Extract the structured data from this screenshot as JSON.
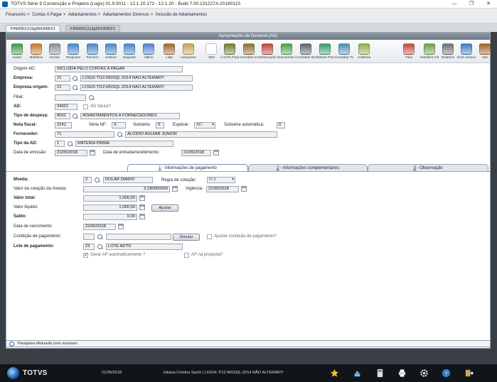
{
  "window": {
    "title": "TOTVS Série 9 Construção e Projetos (Logix) 01.9.5011  -  12.1.20.172  - 12.1.20  - Build 7.00.131227A-20180123",
    "minimize": "—",
    "restore": "❐",
    "close": "✕"
  },
  "breadcrumb": [
    "Financeiro",
    "Contas A Pagar",
    "Adiantamentos",
    "Adiantamentos Diversos",
    "Inclusão de Adiantamentos"
  ],
  "tabs": [
    {
      "label": "FIN0061(1)\\lg991958/21",
      "active": true
    },
    {
      "label": "FIN0061(1)\\lg991958/21",
      "active": false
    }
  ],
  "panel_title": "Apropriações de Despesa (AD)",
  "toolbar": {
    "items": [
      {
        "label": "Incluir",
        "icon": "add-icon",
        "color": "#3f9a48"
      },
      {
        "label": "Modificar",
        "icon": "edit-icon",
        "color": "#c07a2c"
      },
      {
        "label": "Excluir",
        "icon": "delete-icon",
        "color": "#8b8f95"
      },
      {
        "label": "Pesquisar",
        "icon": "search-icon",
        "color": "#4a87c9"
      },
      {
        "label": "Primeiro",
        "icon": "first-icon",
        "color": "#4a87c9"
      },
      {
        "label": "Anterior",
        "icon": "previous-icon",
        "color": "#4a87c9"
      },
      {
        "label": "Seguinte",
        "icon": "next-icon",
        "color": "#4a87c9"
      },
      {
        "label": "Último",
        "icon": "last-icon",
        "color": "#4a87c9"
      },
      {
        "label": "Lista",
        "icon": "list-icon",
        "color": "#a06a2a"
      },
      {
        "label": "Lançamen",
        "icon": "entries-icon",
        "color": "#c6a552"
      },
      {
        "label": "AEN",
        "icon": "aen-icon",
        "color": "#ffffff"
      },
      {
        "label": "A.D.Pa Financeiro",
        "icon": "finance-icon",
        "color": "#6e7f2e"
      },
      {
        "label": "Consultar Impostos",
        "icon": "taxes-icon",
        "color": "#8c6b2e"
      },
      {
        "label": "Observação",
        "icon": "note-icon",
        "color": "#c04040"
      },
      {
        "label": "Documento & Título",
        "icon": "document-icon",
        "color": "#4aa24a"
      },
      {
        "label": "Consultar Itens",
        "icon": "items-icon",
        "color": "#5b6470"
      },
      {
        "label": "Efetivar Previsão",
        "icon": "forecast-icon",
        "color": "#3e9a6a"
      },
      {
        "label": "Consultar Transf.",
        "icon": "transfer-icon",
        "color": "#4a8fb0"
      },
      {
        "label": "Auditoria",
        "icon": "audit-icon",
        "color": "#8bb04a"
      },
      {
        "label": "Filial",
        "icon": "branch-icon",
        "color": "#c54a3a"
      },
      {
        "label": "Detalhes Cotação",
        "icon": "quote-icon",
        "color": "#6ea24a"
      },
      {
        "label": "Relatório",
        "icon": "printer-icon",
        "color": "#6b7077"
      },
      {
        "label": "Docs associados",
        "icon": "attached-docs-icon",
        "color": "#3b7cc4"
      },
      {
        "label": "Sair",
        "icon": "exit-icon",
        "color": "#a0642a"
      }
    ]
  },
  "form": {
    "origem_ad": {
      "label": "Origem AD:",
      "value": "INCLUÍDA PELO CONTAS A PAGAR"
    },
    "empresa": {
      "label": "Empresa:",
      "code": "21",
      "name": "LOGIX-TI12-MSSQL-2014 NÃO ALTERAR!!!"
    },
    "empresa_origem": {
      "label": "Empresa origem:",
      "code": "21",
      "name": "LOGIX-TI12-MSSQL-2014 NÃO ALTERAR!!!"
    },
    "filial": {
      "label": "Filial:",
      "value": ""
    },
    "ad": {
      "label": "AD:",
      "value": "34921",
      "fatura_label": "AD fatura?"
    },
    "tipo_despesa": {
      "label": "Tipo de despesa:",
      "code": "8001",
      "name": "ADIANTAMENTOS A FORNECEDORES"
    },
    "nota_fiscal": {
      "label": "Nota fiscal:",
      "value": "2241",
      "serie_label": "Série NF:",
      "serie": "X",
      "subserie_label": "Subsérie:",
      "subserie": "0",
      "especie_label": "Espécie:",
      "especie": "AD",
      "subserie_auto_label": "Subsérie automática:",
      "subserie_auto": "0"
    },
    "fornecedor": {
      "label": "Fornecedor:",
      "code": "71",
      "name": "ALCIDIO AGUIAR JUNIOR"
    },
    "tipo_ad": {
      "label": "Tipo da AD:",
      "code": "1",
      "name": "MATERIA PRIMA"
    },
    "data_emissao": {
      "label": "Data de emissão:",
      "value": "21/05/2018"
    },
    "data_entrada": {
      "label": "Data de entrada/recebimento:",
      "value": "21/05/2018"
    }
  },
  "subtabs": [
    {
      "num": "1",
      "label": " - Informações de pagamento",
      "active": true
    },
    {
      "num": "2",
      "label": " - Informações complementares",
      "active": false
    },
    {
      "num": "3",
      "label": " - Observação",
      "active": false
    }
  ],
  "payment": {
    "moeda": {
      "label": "Moeda:",
      "code": "2",
      "name": "DOLAR DIARIO"
    },
    "regra_cotacao": {
      "label": "Regra de cotação:",
      "value": "D-3"
    },
    "valor_cotacao": {
      "label": "Valor da cotação da moeda:",
      "value": "3,180000000"
    },
    "vigencia": {
      "label": "Vigência:",
      "value": "21/05/2018"
    },
    "valor_total": {
      "label": "Valor total:",
      "value": "1.000,00"
    },
    "valor_liquido": {
      "label": "Valor líquido:",
      "value": "1.000,00",
      "button": "Ajustar"
    },
    "saldo": {
      "label": "Saldo:",
      "value": "0.00"
    },
    "data_vencimento": {
      "label": "Data de vencimento:",
      "value": "22/05/2018"
    },
    "condicao": {
      "label": "Condição de pagamento:",
      "value": "",
      "button": "Simular",
      "ajustar_label": "Ajustar condição de pagamento?"
    },
    "lote": {
      "label": "Lote de pagamento:",
      "code": "23",
      "name": "LOTE ADTO"
    },
    "gerar_ap": {
      "label": "Gerar AP automaticamente ?",
      "checked": true
    },
    "ap_proposta": {
      "label": "AP na proposta?",
      "checked": false
    }
  },
  "status": {
    "message": "Pesquisa efetuada com sucesso."
  },
  "taskbar": {
    "brand": "TOTVS",
    "date": "21/05/2018",
    "user_company": "Juliana Cristina Sacht | LOGIX-TI12-MSSQL-2014 NÃO ALTERAR!!!",
    "icons": [
      "favorites-star-icon",
      "erp-icon",
      "calculator-icon",
      "printer-icon",
      "settings-gear-icon",
      "help-icon",
      "exit-icon"
    ]
  }
}
